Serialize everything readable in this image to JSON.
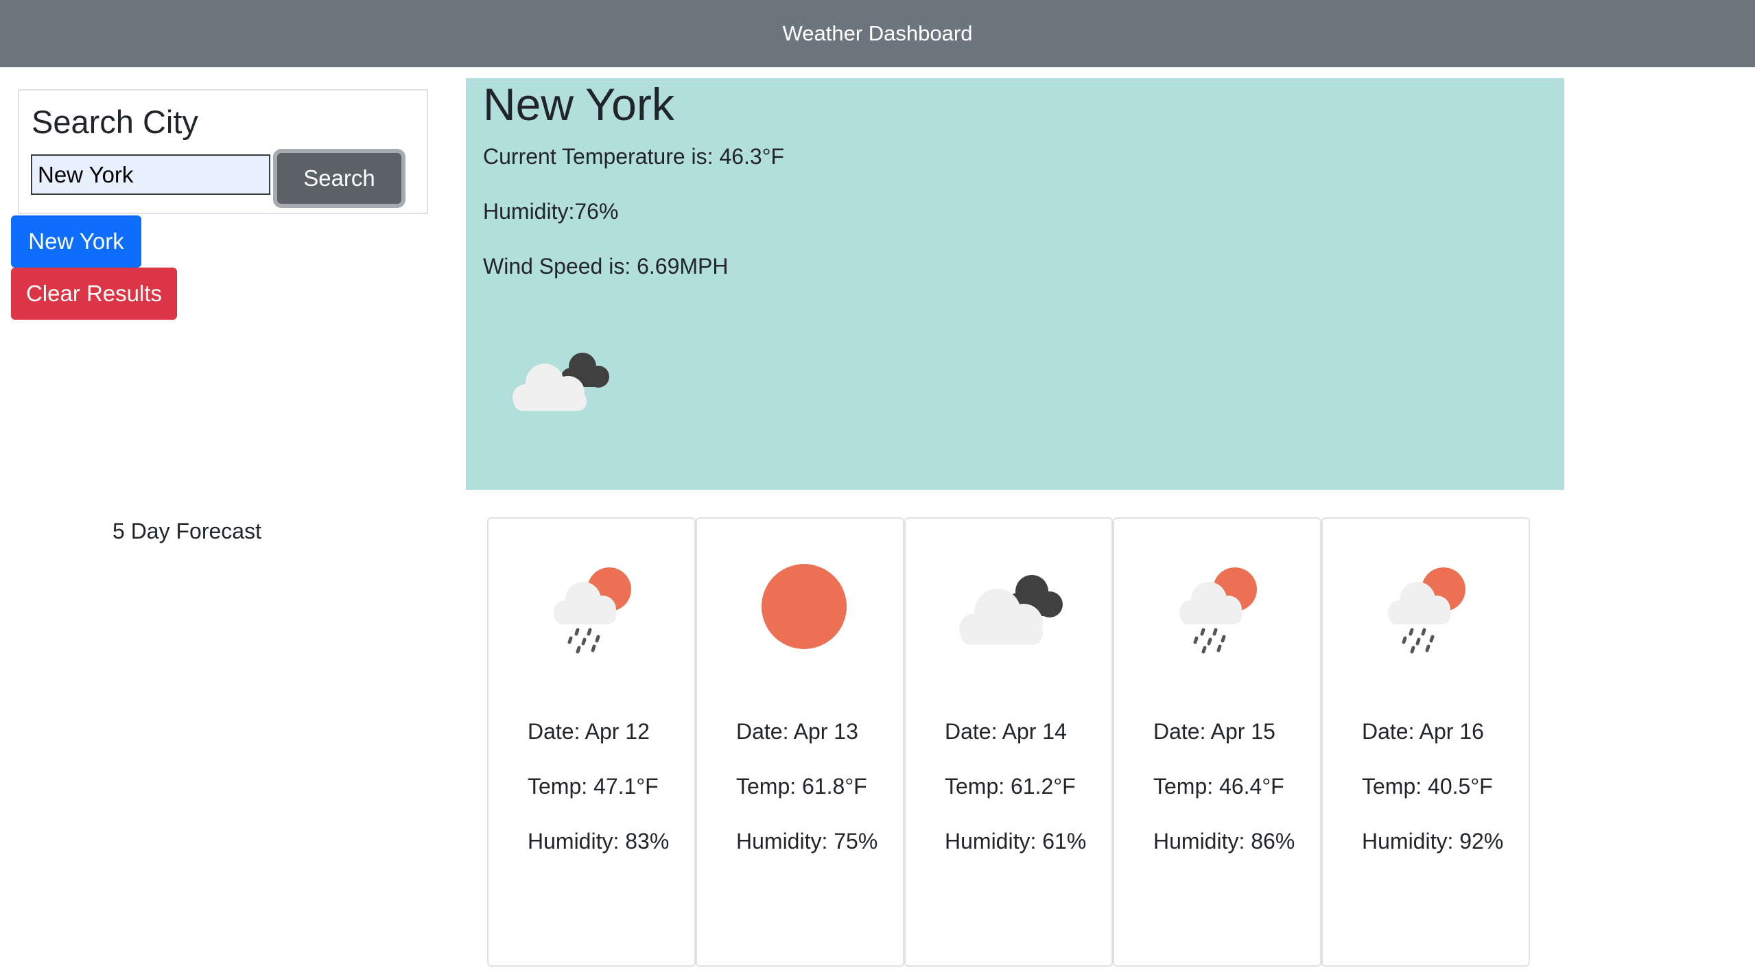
{
  "header": {
    "title": "Weather Dashboard"
  },
  "search": {
    "heading": "Search City",
    "input_value": "New York",
    "button_label": "Search"
  },
  "history": {
    "city_button": "New York",
    "clear_button": "Clear Results"
  },
  "current": {
    "city": "New York",
    "temperature": "Current Temperature is: 46.3°F",
    "humidity": "Humidity:76%",
    "wind": "Wind Speed is: 6.69MPH",
    "icon": "cloud-icon"
  },
  "forecast": {
    "title": "5 Day Forecast",
    "days": [
      {
        "date": "Date: Apr 12",
        "temp": "Temp: 47.1°F",
        "humidity": "Humidity: 83%",
        "icon": "rain-sun-icon"
      },
      {
        "date": "Date: Apr 13",
        "temp": "Temp: 61.8°F",
        "humidity": "Humidity: 75%",
        "icon": "sun-icon"
      },
      {
        "date": "Date: Apr 14",
        "temp": "Temp: 61.2°F",
        "humidity": "Humidity: 61%",
        "icon": "cloud-icon"
      },
      {
        "date": "Date: Apr 15",
        "temp": "Temp: 46.4°F",
        "humidity": "Humidity: 86%",
        "icon": "rain-sun-icon"
      },
      {
        "date": "Date: Apr 16",
        "temp": "Temp: 40.5°F",
        "humidity": "Humidity: 92%",
        "icon": "rain-sun-icon"
      }
    ]
  },
  "colors": {
    "header_bg": "#6c757d",
    "panel_bg": "#b2dfdb",
    "primary": "#0d6efd",
    "danger": "#dc3545",
    "sun": "#ec7054"
  }
}
